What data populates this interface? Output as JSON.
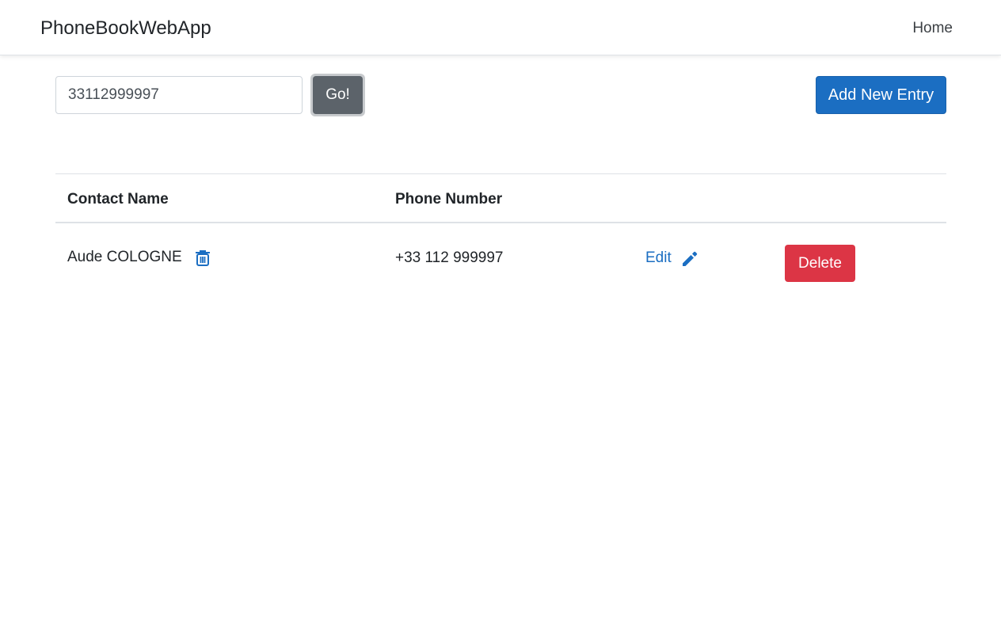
{
  "navbar": {
    "brand": "PhoneBookWebApp",
    "home_link": "Home"
  },
  "search": {
    "value": "33112999997",
    "go_label": "Go!"
  },
  "toolbar": {
    "add_label": "Add New Entry"
  },
  "table": {
    "headers": [
      "Contact Name",
      "Phone Number"
    ],
    "rows": [
      {
        "name": "Aude COLOGNE",
        "phone": "+33 112 999997",
        "edit_label": "Edit",
        "delete_label": "Delete",
        "name_icon": "trash-icon",
        "edit_icon": "pencil-icon"
      }
    ]
  },
  "colors": {
    "primary": "#1b6ec2",
    "secondary": "#5c636a",
    "danger": "#dc3545",
    "link": "#1b6ec2"
  }
}
